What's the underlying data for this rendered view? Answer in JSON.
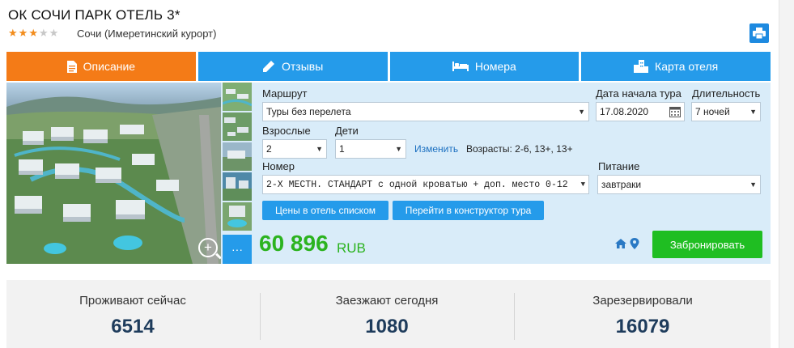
{
  "hotel": {
    "title": "ОК СОЧИ ПАРК ОТЕЛЬ 3*",
    "stars_filled": 3,
    "stars_total": 5,
    "location": "Сочи (Имеретинский курорт)"
  },
  "icons": {
    "print": "printer-icon",
    "description": "document-icon",
    "reviews": "pencil-icon",
    "rooms": "bed-icon",
    "map": "buildings-icon",
    "zoom": "zoom-in-icon",
    "home": "home-icon",
    "pin": "location-pin-icon"
  },
  "colors": {
    "tab_active": "#f47b17",
    "tab": "#259bea",
    "price": "#2bb31f",
    "book": "#1fbe22",
    "stat_value": "#1e3c5c"
  },
  "tabs": [
    {
      "label": "Описание",
      "active": true
    },
    {
      "label": "Отзывы",
      "active": false
    },
    {
      "label": "Номера",
      "active": false
    },
    {
      "label": "Карта отеля",
      "active": false
    }
  ],
  "form": {
    "route_label": "Маршрут",
    "route_value": "Туры без перелета",
    "date_label": "Дата начала тура",
    "date_value": "17.08.2020",
    "duration_label": "Длительность",
    "duration_value": "7 ночей",
    "adults_label": "Взрослые",
    "adults_value": "2",
    "children_label": "Дети",
    "children_value": "1",
    "change_link": "Изменить",
    "ages_text": "Возрасты: 2-6, 13+, 13+",
    "room_label": "Номер",
    "room_value": "2-Х МЕСТН. СТАНДАРТ с одной кроватью + доп. место 0-12",
    "meal_label": "Питание",
    "meal_value": "завтраки",
    "list_prices_button": "Цены в отель списком",
    "constructor_button": "Перейти в конструктор тура"
  },
  "photos": {
    "more_label": "···"
  },
  "price": {
    "amount": "60 896",
    "currency": "RUB",
    "book_button": "Забронировать"
  },
  "stats": [
    {
      "label": "Проживают сейчас",
      "value": "6514"
    },
    {
      "label": "Заезжают сегодня",
      "value": "1080"
    },
    {
      "label": "Зарезервировали",
      "value": "16079"
    }
  ]
}
